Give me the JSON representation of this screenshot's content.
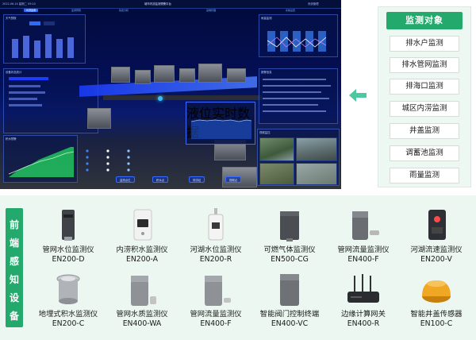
{
  "dashboard": {
    "topbar": {
      "left": "2022-06-14 星期二 09:10",
      "center": "城市内涝监测预警平台",
      "right": "系统管理"
    },
    "nav": {
      "active": "内涝监测",
      "items": [
        "监测预警",
        "综合分析",
        "运维管理",
        "系统设置"
      ]
    },
    "panels": {
      "top_left": "天气预报",
      "mid_left": "设备状态统计",
      "bottom_left": "积水预警",
      "top_right": "雨量监测",
      "mid_right": "报警信息",
      "bottom_right": "视频监控",
      "popup": "液位实时数据"
    },
    "bottom_buttons": [
      "监测点位",
      "积水点",
      "排涝站",
      "视频点"
    ]
  },
  "monitoring": {
    "title": "监测对象",
    "items": [
      "排水户监测",
      "排水管网监测",
      "排海口监测",
      "城区内涝监测",
      "井盖监测",
      "调蓄池监测",
      "雨量监测"
    ]
  },
  "devices_section": {
    "label_chars": [
      "前",
      "端",
      "感",
      "知",
      "设",
      "备"
    ],
    "devices": [
      {
        "name": "管网水位监测仪",
        "model": "EN200-D",
        "icon": "level-meter-icon"
      },
      {
        "name": "内涝积水监测仪",
        "model": "EN200-A",
        "icon": "waterlogging-sensor-icon"
      },
      {
        "name": "河湖水位监测仪",
        "model": "EN200-R",
        "icon": "radar-level-icon"
      },
      {
        "name": "可燃气体监测仪",
        "model": "EN500-CG",
        "icon": "gas-detector-icon"
      },
      {
        "name": "管网流量监测仪",
        "model": "EN400-F",
        "icon": "flow-meter-icon"
      },
      {
        "name": "河湖流速监测仪",
        "model": "EN200-V",
        "icon": "velocity-meter-icon"
      },
      {
        "name": "地埋式积水监测仪",
        "model": "EN200-C",
        "icon": "buried-sensor-icon"
      },
      {
        "name": "管网水质监测仪",
        "model": "EN400-WA",
        "icon": "water-quality-icon"
      },
      {
        "name": "管网流量监测仪",
        "model": "EN400-F",
        "icon": "flow-meter-icon"
      },
      {
        "name": "智能阀门控制终端",
        "model": "EN400-VC",
        "icon": "valve-controller-icon"
      },
      {
        "name": "边缘计算网关",
        "model": "EN400-R",
        "icon": "gateway-router-icon"
      },
      {
        "name": "智能井盖传感器",
        "model": "EN100-C",
        "icon": "manhole-sensor-icon"
      }
    ]
  },
  "colors": {
    "accent": "#22a96b",
    "panel_bg": "#eef8f2",
    "section_bg": "#ebf7f0",
    "dash_blue": "#041058"
  }
}
